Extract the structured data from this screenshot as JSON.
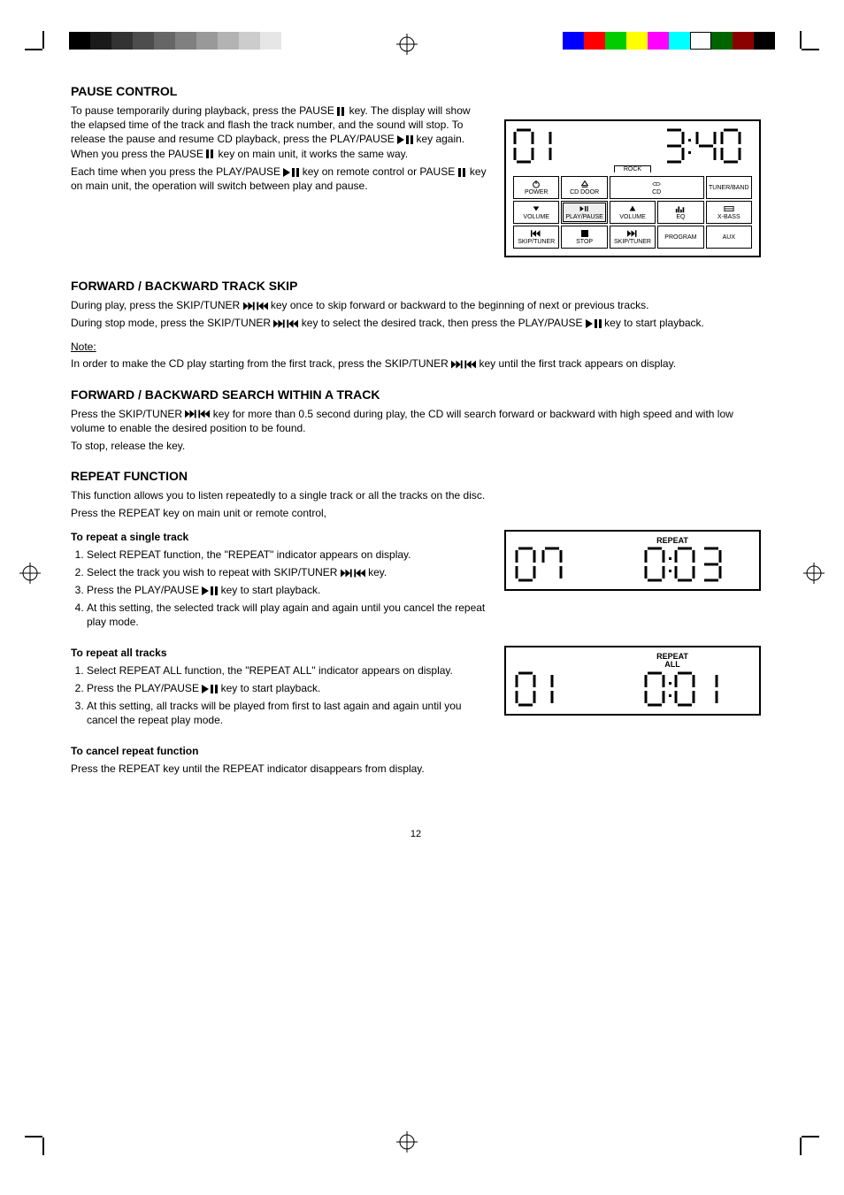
{
  "section_pause": {
    "heading": "PAUSE CONTROL",
    "text1_a": "To pause temporarily during playback, press the PAUSE ",
    "text1_b": " key. The display will show the elapsed time of the track and flash the track number, and the sound will stop. To release the pause and resume CD playback, press the PLAY/PAUSE ",
    "text1_c": " key again. When you press the PAUSE ",
    "text1_d": " key on main unit, it works the same way.",
    "text2_a": "Each time when you press the PLAY/PAUSE ",
    "text2_b": " key on remote control or PAUSE ",
    "text2_c": " key on main unit, the operation will switch between play and pause."
  },
  "section_skip": {
    "heading": "FORWARD / BACKWARD TRACK SKIP",
    "text_a": "During play, press the SKIP/TUNER ",
    "text_b": " key once to skip forward or backward to the beginning of next or previous tracks.",
    "text2_a": "During stop mode, press the SKIP/TUNER ",
    "text2_b": " key to select the desired track, then press the PLAY/PAUSE   ",
    "text2_c": " key to start playback.",
    "note_label": "Note:",
    "note_a": "In order to make the CD play starting from the first track, press the SKIP/TUNER ",
    "note_b": " key until the first track appears on display."
  },
  "section_search": {
    "heading": "FORWARD / BACKWARD SEARCH WITHIN A TRACK",
    "text1_a": "Press the SKIP/TUNER ",
    "text1_b": " key for more than 0.5 second during play, the CD will search forward or backward with high speed and with low volume to enable the desired position to be found.",
    "text2": "To stop, release the key."
  },
  "section_repeat": {
    "heading": "REPEAT FUNCTION",
    "intro1": "This function allows you to listen repeatedly to a single track or all the tracks on the disc.",
    "intro2": "Press the REPEAT key on main unit or remote control,",
    "sub1_head": "To repeat a single track",
    "sub1_li1": "Select REPEAT function, the \"REPEAT\" indicator appears on display.",
    "sub1_li2_a": "Select the track you wish to repeat with SKIP/TUNER ",
    "sub1_li2_b": " key.",
    "sub1_li3_a": "Press the PLAY/PAUSE ",
    "sub1_li3_b": " key to start playback.",
    "sub1_li4": "At this setting, the selected track will play again and again until you cancel the repeat play mode.",
    "sub2_head": "To repeat all tracks",
    "sub2_li1": "Select REPEAT ALL function, the \"REPEAT ALL\" indicator appears on display.",
    "sub2_li2_a": "Press the PLAY/PAUSE ",
    "sub2_li2_b": " key to start playback.",
    "sub2_li3": "At this setting, all tracks will be played from first to last again and again until you cancel the repeat play mode.",
    "cancel_head": "To cancel repeat function",
    "cancel": "Press the REPEAT key until the REPEAT indicator disappears from display."
  },
  "display_main": {
    "track": "01",
    "time": "3:40",
    "rock": "ROCK",
    "buttons": {
      "r1": [
        "POWER",
        "CD DOOR",
        "CD",
        "TUNER/BAND"
      ],
      "r2": [
        "VOLUME",
        "PLAY/PAUSE",
        "VOLUME",
        "EQ",
        "X-BASS"
      ],
      "r3": [
        "SKIP/TUNER",
        "STOP",
        "SKIP/TUNER",
        "PROGRAM",
        "AUX"
      ]
    }
  },
  "display_repeat1": {
    "indicator": "REPEAT",
    "track": "07",
    "time": "0:03"
  },
  "display_repeat2": {
    "indicator_l1": "REPEAT",
    "indicator_l2": "ALL",
    "track": "01",
    "time": "0:01"
  },
  "page_number": "12"
}
